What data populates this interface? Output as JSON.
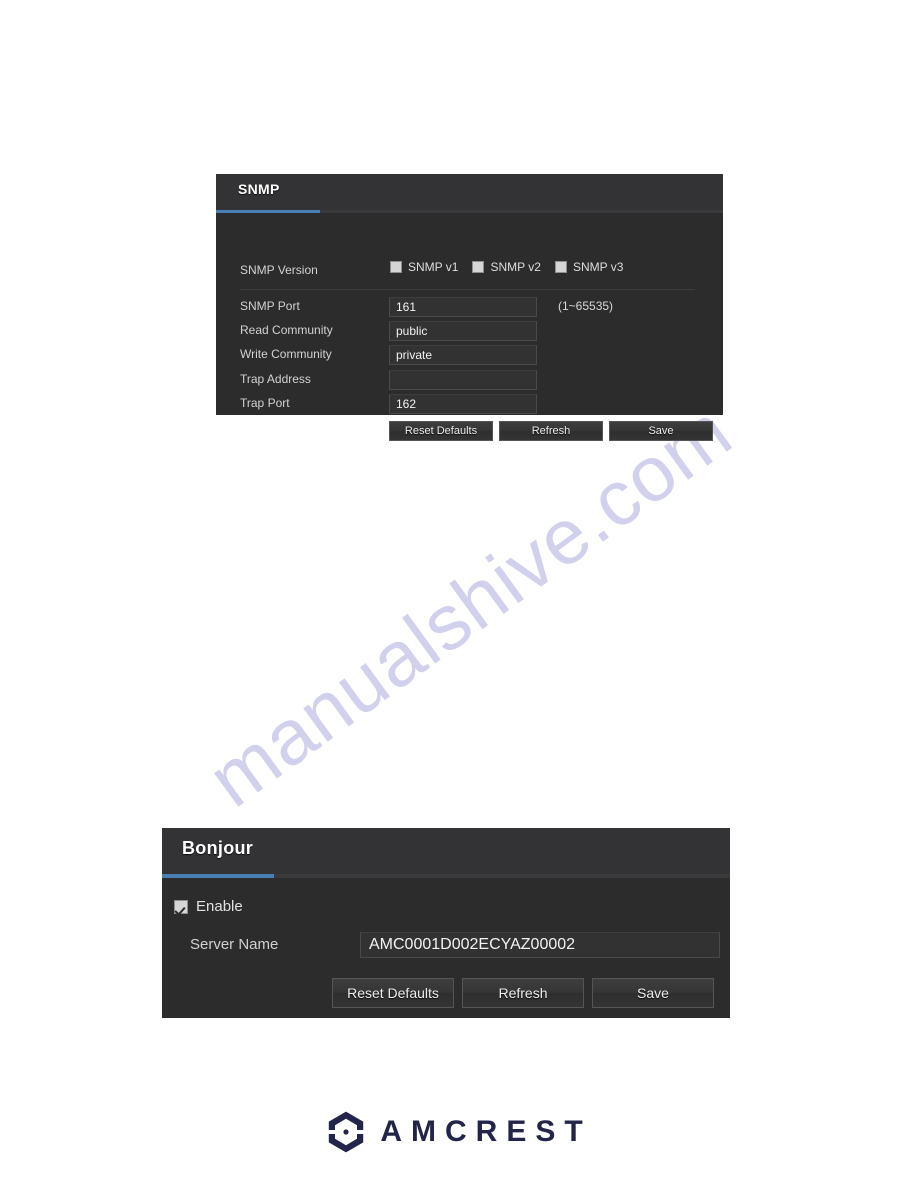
{
  "page": {
    "watermark_text": "manualshive.com",
    "background": "#ffffff"
  },
  "theme": {
    "panel_bg": "#2c2c2c",
    "header_bg": "#333336",
    "accent": "#4a7fb5",
    "input_bg": "#323232",
    "text": "#d2d2d2",
    "logo_navy": "#232449",
    "logo_dot_blue": "#2f6fd0"
  },
  "snmp_panel": {
    "title": "SNMP",
    "version_label": "SNMP Version",
    "versions": [
      {
        "label": "SNMP v1",
        "checked": false
      },
      {
        "label": "SNMP v2",
        "checked": false
      },
      {
        "label": "SNMP v3",
        "checked": false
      }
    ],
    "fields": [
      {
        "label": "SNMP Port",
        "value": "161",
        "hint": "(1~65535)"
      },
      {
        "label": "Read Community",
        "value": "public",
        "hint": ""
      },
      {
        "label": "Write Community",
        "value": "private",
        "hint": ""
      },
      {
        "label": "Trap Address",
        "value": "",
        "hint": ""
      },
      {
        "label": "Trap Port",
        "value": "162",
        "hint": ""
      }
    ],
    "buttons": {
      "reset": "Reset Defaults",
      "refresh": "Refresh",
      "save": "Save"
    }
  },
  "bonjour_panel": {
    "title": "Bonjour",
    "enable": {
      "label": "Enable",
      "checked": true
    },
    "server_name": {
      "label": "Server Name",
      "value": "AMC0001D002ECYAZ00002"
    },
    "buttons": {
      "reset": "Reset Defaults",
      "refresh": "Refresh",
      "save": "Save"
    }
  },
  "footer": {
    "brand": "AMCREST",
    "mark": "amcrest-hexagon-camera-icon"
  }
}
